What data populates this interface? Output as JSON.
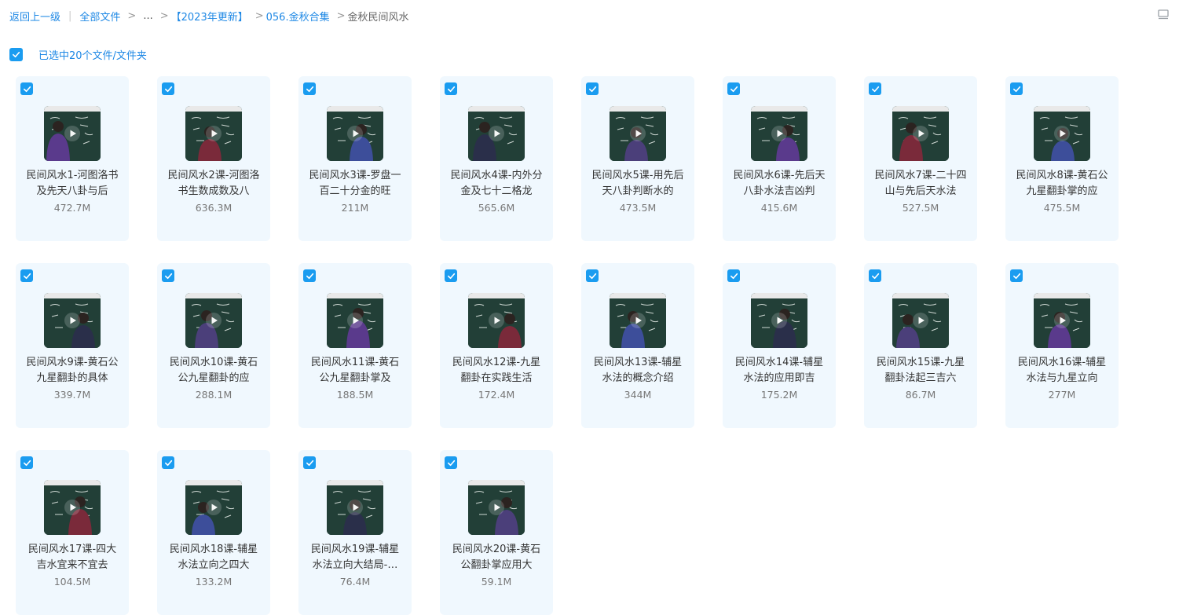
{
  "breadcrumb": {
    "back": "返回上一级",
    "all_files": "全部文件",
    "ellipsis": "...",
    "folder1": "【2023年更新】",
    "folder2": "056.金秋合集",
    "current": "金秋民间风水",
    "sep": ">",
    "pipe": "|"
  },
  "selection": {
    "label": "已选中20个文件/文件夹",
    "checked": true
  },
  "colors": {
    "accent": "#1a9cf0",
    "card_bg": "#f0f8fe",
    "link": "#1e88e5"
  },
  "files": [
    {
      "name": "民间风水1-河图洛书及先天八卦与后",
      "size": "472.7M",
      "checked": true
    },
    {
      "name": "民间风水2课-河图洛书生数成数及八",
      "size": "636.3M",
      "checked": true
    },
    {
      "name": "民间风水3课-罗盘一百二十分金的旺",
      "size": "211M",
      "checked": true
    },
    {
      "name": "民间风水4课-内外分金及七十二格龙",
      "size": "565.6M",
      "checked": true
    },
    {
      "name": "民间风水5课-用先后天八卦判断水的",
      "size": "473.5M",
      "checked": true
    },
    {
      "name": "民间风水6课-先后天八卦水法吉凶判",
      "size": "415.6M",
      "checked": true
    },
    {
      "name": "民间风水7课-二十四山与先后天水法",
      "size": "527.5M",
      "checked": true
    },
    {
      "name": "民间风水8课-黄石公九星翻卦掌的应",
      "size": "475.5M",
      "checked": true
    },
    {
      "name": "民间风水9课-黄石公九星翻卦的具体",
      "size": "339.7M",
      "checked": true
    },
    {
      "name": "民间风水10课-黄石公九星翻卦的应",
      "size": "288.1M",
      "checked": true
    },
    {
      "name": "民间风水11课-黄石公九星翻卦掌及",
      "size": "188.5M",
      "checked": true
    },
    {
      "name": "民间风水12课-九星翻卦在实践生活",
      "size": "172.4M",
      "checked": true
    },
    {
      "name": "民间风水13课-辅星水法的概念介绍",
      "size": "344M",
      "checked": true
    },
    {
      "name": "民间风水14课-辅星水法的应用即吉",
      "size": "175.2M",
      "checked": true
    },
    {
      "name": "民间风水15课-九星翻卦法起三吉六",
      "size": "86.7M",
      "checked": true
    },
    {
      "name": "民间风水16课-辅星水法与九星立向",
      "size": "277M",
      "checked": true
    },
    {
      "name": "民间风水17课-四大吉水宜来不宜去",
      "size": "104.5M",
      "checked": true
    },
    {
      "name": "民间风水18课-辅星水法立向之四大",
      "size": "133.2M",
      "checked": true
    },
    {
      "name": "民间风水19课-辅星水法立向大结局-…",
      "size": "76.4M",
      "checked": true
    },
    {
      "name": "民间风水20课-黄石公翻卦掌应用大",
      "size": "59.1M",
      "checked": true
    }
  ]
}
